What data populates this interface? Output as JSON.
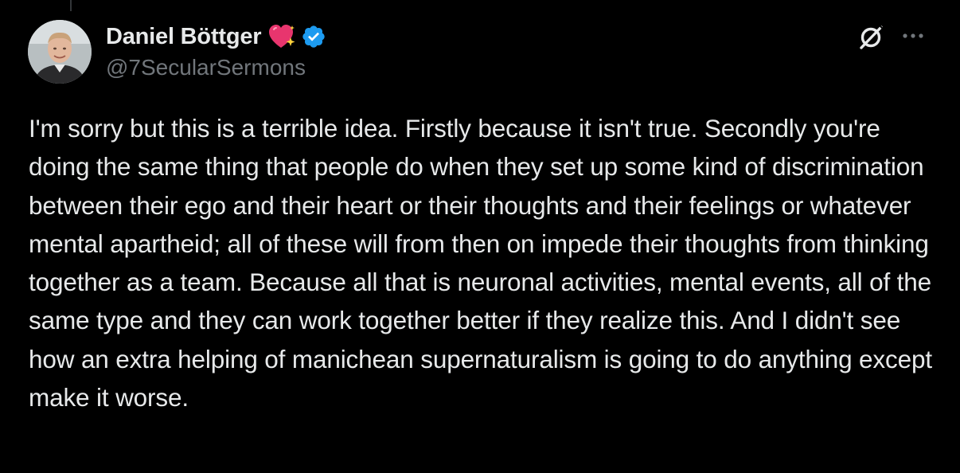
{
  "thread": {
    "has_connector_line": true
  },
  "author": {
    "display_name": "Daniel Böttger",
    "handle": "@7SecularSermons",
    "name_emoji": "sparkling-heart-icon",
    "verified": true
  },
  "actions": {
    "grok_icon": "grok-icon",
    "more_icon": "more-options-icon"
  },
  "tweet": {
    "text": "I'm sorry but this is a terrible idea. Firstly because it isn't true. Secondly you're doing the same thing that people do when they set up some kind of discrimination between their ego and their heart or their thoughts and their feelings or whatever mental apartheid; all of these will from then on impede their thoughts from thinking together as a team. Because all that is neuronal activities, mental events, all of the same type and they can work together better if they realize this. And I didn't see how an extra helping of manichean supernaturalism is going to do anything except make it worse."
  },
  "colors": {
    "background": "#000000",
    "primary_text": "#e7e9ea",
    "secondary_text": "#71767b",
    "verified_blue": "#1d9bf0",
    "heart_pink": "#e8356e"
  }
}
